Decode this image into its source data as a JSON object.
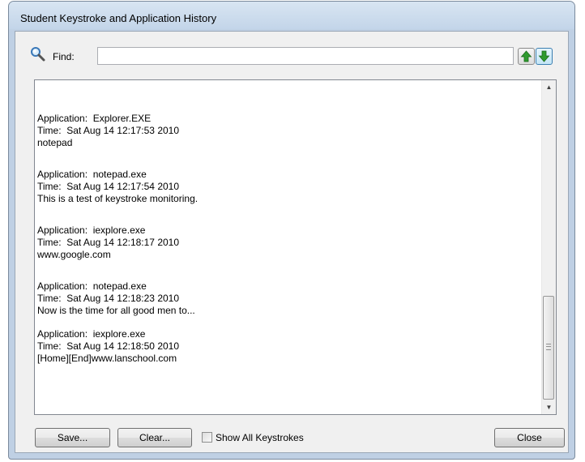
{
  "window": {
    "title": "Student Keystroke and Application History"
  },
  "find": {
    "label": "Find:",
    "value": "",
    "placeholder": "",
    "icon": "magnifier-icon",
    "up_icon": "green-up-arrow-icon",
    "down_icon": "green-down-arrow-icon"
  },
  "log": {
    "entries": [
      {
        "app": "Application:  Explorer.EXE",
        "time": "Time:  Sat Aug 14 12:17:53 2010",
        "text": "notepad"
      },
      {
        "app": "Application:  notepad.exe",
        "time": "Time:  Sat Aug 14 12:17:54 2010",
        "text": "This is a test of keystroke monitoring."
      },
      {
        "app": "Application:  iexplore.exe",
        "time": "Time:  Sat Aug 14 12:18:17 2010",
        "text": "www.google.com"
      },
      {
        "app": "Application:  notepad.exe",
        "time": "Time:  Sat Aug 14 12:18:23 2010",
        "text": "Now is the time for all good men to..."
      },
      {
        "app": "Application:  iexplore.exe",
        "time": "Time:  Sat Aug 14 12:18:50 2010",
        "text": "[Home][End]www.lanschool.com"
      }
    ]
  },
  "buttons": {
    "save": "Save...",
    "clear": "Clear...",
    "close": "Close"
  },
  "options": {
    "show_all_keystrokes_label": "Show All Keystrokes",
    "show_all_keystrokes_checked": false
  },
  "colors": {
    "window_frame": "#c3d5e9",
    "arrow_green": "#2e9a2e",
    "arrow_highlight": "#3c7fb1"
  }
}
